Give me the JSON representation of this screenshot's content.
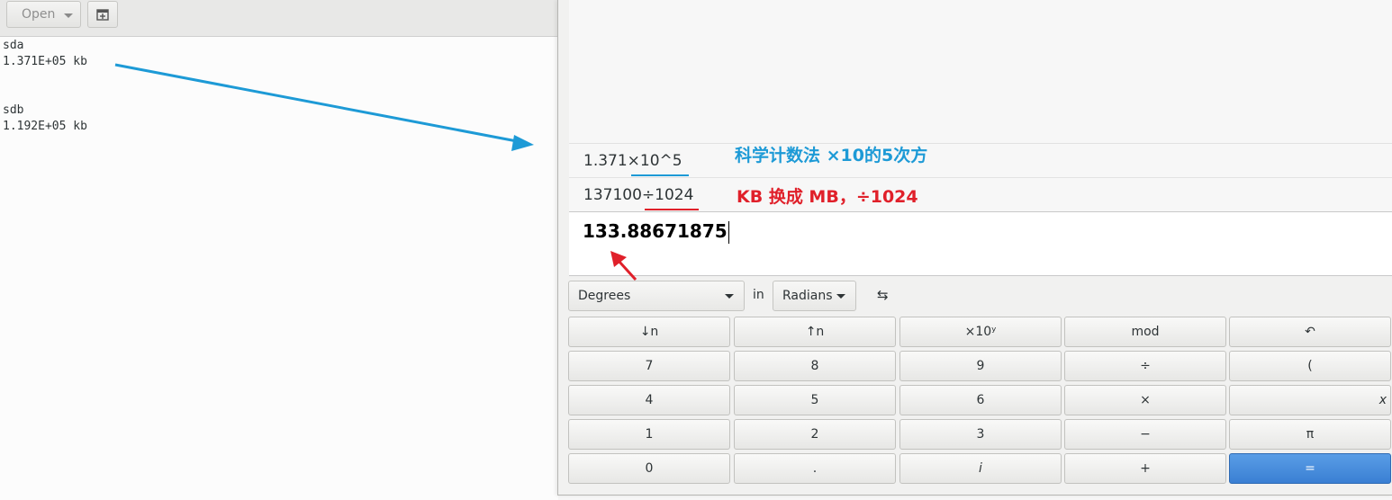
{
  "editor": {
    "open_label": "Open",
    "lines": [
      "sda",
      "1.371E+05 kb",
      "",
      "",
      "sdb",
      "1.192E+05 kb"
    ]
  },
  "calculator": {
    "history": [
      "1.371×10^5",
      "137100÷1024"
    ],
    "result": "133.88671875",
    "angle_unit": "Degrees",
    "in_label": "in",
    "target_unit": "Radians",
    "swap_icon": "⇆",
    "keys": [
      [
        "↓n",
        "↑n",
        "×10ʸ",
        "mod",
        "↶"
      ],
      [
        "7",
        "8",
        "9",
        "÷",
        "("
      ],
      [
        "4",
        "5",
        "6",
        "×",
        "x"
      ],
      [
        "1",
        "2",
        "3",
        "−",
        "π"
      ],
      [
        "0",
        ".",
        "i",
        "+",
        "="
      ]
    ]
  },
  "annotations": {
    "sci_note": "科学计数法 ×10的5次方",
    "kb_note": "KB 换成 MB，÷1024",
    "blue": "#1d9ad6",
    "red": "#e0202a"
  }
}
